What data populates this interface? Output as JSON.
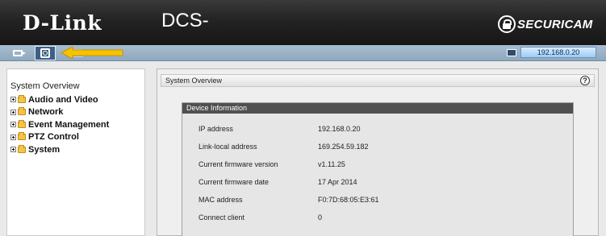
{
  "header": {
    "brand": "D-Link",
    "model": "DCS-",
    "logo_text": "SECURICAM"
  },
  "toolbar": {
    "items": [
      {
        "name": "live-video",
        "icon": "camera-icon"
      },
      {
        "name": "setup",
        "icon": "setup-icon"
      },
      {
        "name": "maintenance",
        "icon": "tools-icon"
      }
    ],
    "ip_display": "192.168.0.20",
    "arrow_color": "#f5c400"
  },
  "sidebar": {
    "title": "System Overview",
    "items": [
      {
        "label": "Audio and Video"
      },
      {
        "label": "Network"
      },
      {
        "label": "Event Management"
      },
      {
        "label": "PTZ Control"
      },
      {
        "label": "System"
      }
    ]
  },
  "main": {
    "title": "System Overview",
    "help_label": "?",
    "device_info": {
      "title": "Device Information",
      "rows": [
        {
          "label": "IP address",
          "value": "192.168.0.20"
        },
        {
          "label": "Link-local address",
          "value": "169.254.59.182"
        },
        {
          "label": "Current firmware version",
          "value": "v1.11.25"
        },
        {
          "label": "Current firmware date",
          "value": "17 Apr 2014"
        },
        {
          "label": "MAC address",
          "value": "F0:7D:68:05:E3:61"
        },
        {
          "label": "Connect client",
          "value": "0"
        }
      ]
    }
  },
  "colors": {
    "header_bg": "#1e1e1e",
    "toolbar_bg": "#9db4c9",
    "device_title_bg": "#505050"
  }
}
